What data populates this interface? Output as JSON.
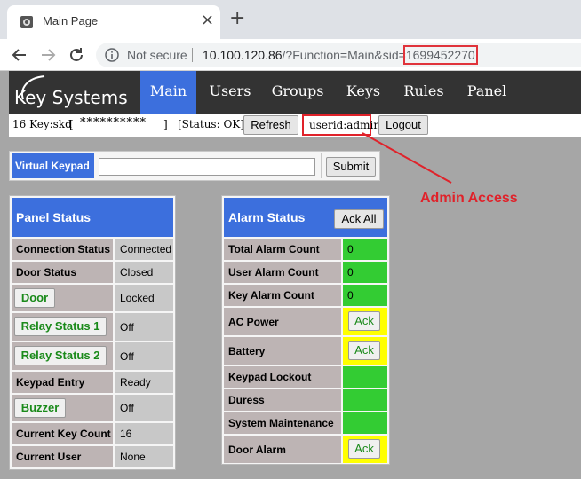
{
  "browser": {
    "tab_title": "Main Page",
    "tab_close": "×",
    "new_tab": "+",
    "not_secure": "Not secure",
    "url_host": "10.100.120.86",
    "url_path": "/?Function=Main&sid=",
    "url_sid": "1699452270"
  },
  "header": {
    "logo": "Key Systems",
    "nav": [
      "Main",
      "Users",
      "Groups",
      "Keys",
      "Rules",
      "Panel"
    ]
  },
  "infobar": {
    "key_info": "16 Key:skd",
    "bracket_open": "[",
    "masked_key": "**********",
    "bracket_close": "]",
    "status": "[Status: OK]",
    "refresh_label": "Refresh",
    "userid": "userid:admin",
    "logout_label": "Logout"
  },
  "annotation": {
    "text": "Admin Access",
    "color": "#e0222a"
  },
  "keypad": {
    "label": "Virtual Keypad",
    "input_value": "",
    "submit_label": "Submit"
  },
  "panel_status": {
    "title": "Panel Status",
    "rows": [
      {
        "label": "Connection Status",
        "value": "Connected"
      },
      {
        "label": "Door Status",
        "value": "Closed"
      },
      {
        "label": "Door",
        "value": "Locked"
      },
      {
        "label": "Relay Status 1",
        "value": "Off"
      },
      {
        "label": "Relay Status 2",
        "value": "Off"
      },
      {
        "label": "Keypad Entry",
        "value": "Ready"
      },
      {
        "label": "Buzzer",
        "value": "Off"
      },
      {
        "label": "Current Key Count",
        "value": "16"
      },
      {
        "label": "Current User",
        "value": "None"
      }
    ]
  },
  "alarm_status": {
    "title": "Alarm Status",
    "ack_all_label": "Ack All",
    "ack_label": "Ack",
    "rows": [
      {
        "label": "Total Alarm Count",
        "value": "0"
      },
      {
        "label": "User Alarm Count",
        "value": "0"
      },
      {
        "label": "Key Alarm Count",
        "value": "0"
      },
      {
        "label": "AC Power",
        "value": ""
      },
      {
        "label": "Battery",
        "value": ""
      },
      {
        "label": "Keypad Lockout",
        "value": ""
      },
      {
        "label": "Duress",
        "value": ""
      },
      {
        "label": "System Maintenance",
        "value": ""
      },
      {
        "label": "Door Alarm",
        "value": ""
      }
    ]
  },
  "colors": {
    "accent": "#3c6fdd",
    "header_bg": "#333333",
    "ok_green": "#33cc33",
    "alert_yellow": "#ffff00",
    "label_bg": "#bdb4b4",
    "page_bg": "#a6a6a6"
  }
}
